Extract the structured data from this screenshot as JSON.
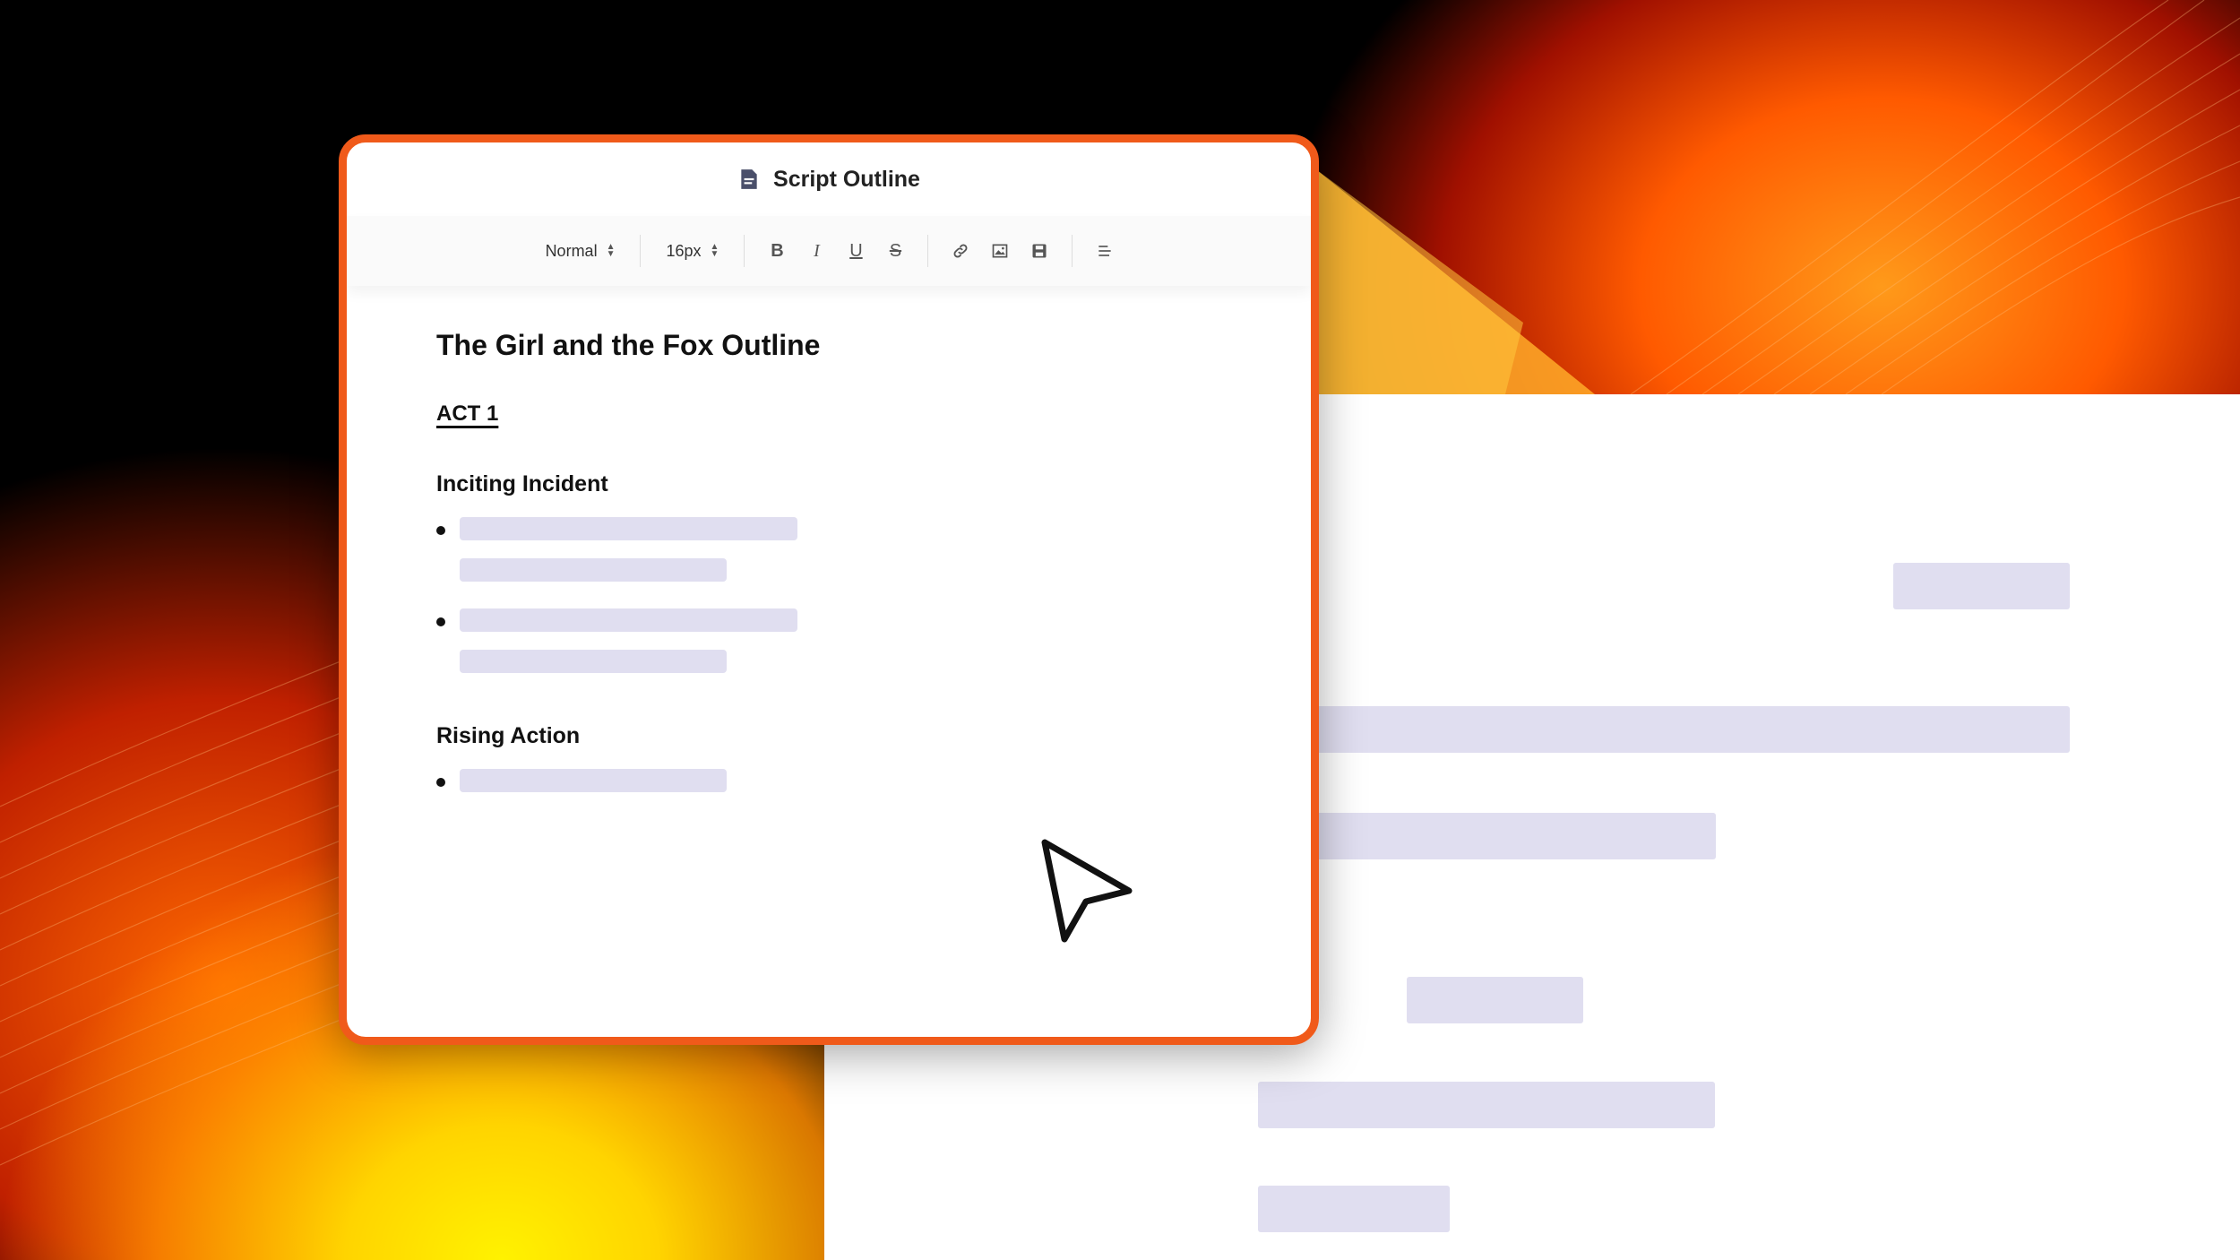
{
  "window": {
    "title": "Script Outline",
    "title_icon": "document-icon"
  },
  "toolbar": {
    "style_select": "Normal",
    "size_select": "16px",
    "buttons": [
      {
        "name": "bold",
        "icon": "bold-icon",
        "glyph": "B"
      },
      {
        "name": "italic",
        "icon": "italic-icon",
        "glyph": "I"
      },
      {
        "name": "underline",
        "icon": "underline-icon",
        "glyph": "U"
      },
      {
        "name": "strikethrough",
        "icon": "strikethrough-icon",
        "glyph": "S"
      },
      {
        "name": "link",
        "icon": "link-icon"
      },
      {
        "name": "image",
        "icon": "image-icon"
      },
      {
        "name": "save",
        "icon": "save-icon"
      },
      {
        "name": "align",
        "icon": "align-icon"
      }
    ]
  },
  "document": {
    "title": "The Girl and the Fox Outline",
    "act": "ACT 1",
    "sections": [
      {
        "heading": "Inciting Incident"
      },
      {
        "heading": "Rising Action"
      }
    ]
  },
  "colors": {
    "accent_border": "#f05a1a",
    "placeholder": "#e0def0"
  }
}
